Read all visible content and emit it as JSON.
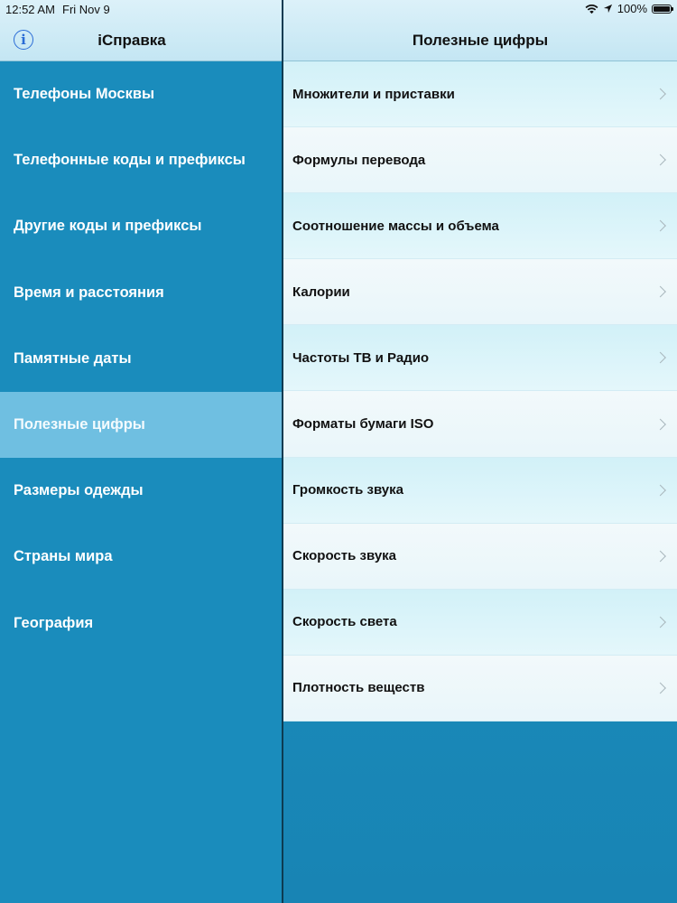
{
  "status_bar": {
    "time": "12:52 AM",
    "date": "Fri Nov 9",
    "battery": "100%"
  },
  "master": {
    "info_icon": "info-icon",
    "info_glyph": "i",
    "title": "iСправка",
    "items": [
      {
        "label": "Телефоны Москвы"
      },
      {
        "label": "Телефонные коды и префиксы"
      },
      {
        "label": "Другие коды и префиксы"
      },
      {
        "label": "Время и расстояния"
      },
      {
        "label": "Памятные даты"
      },
      {
        "label": "Полезные цифры"
      },
      {
        "label": "Размеры одежды"
      },
      {
        "label": "Страны мира"
      },
      {
        "label": "География"
      }
    ],
    "selected_index": 5
  },
  "detail": {
    "title": "Полезные цифры",
    "rows": [
      {
        "label": "Множители и приставки"
      },
      {
        "label": "Формулы перевода"
      },
      {
        "label": "Соотношение массы и объема"
      },
      {
        "label": "Калории"
      },
      {
        "label": "Частоты ТВ и Радио"
      },
      {
        "label": "Форматы бумаги ISO"
      },
      {
        "label": "Громкость звука"
      },
      {
        "label": "Скорость звука"
      },
      {
        "label": "Скорость света"
      },
      {
        "label": "Плотность веществ"
      }
    ]
  },
  "colors": {
    "master_background": "#1a8cbc",
    "selected_item": "#6fbfe1",
    "nav_bar": "#d3ecf6",
    "info_accent": "#2a6cd6"
  }
}
